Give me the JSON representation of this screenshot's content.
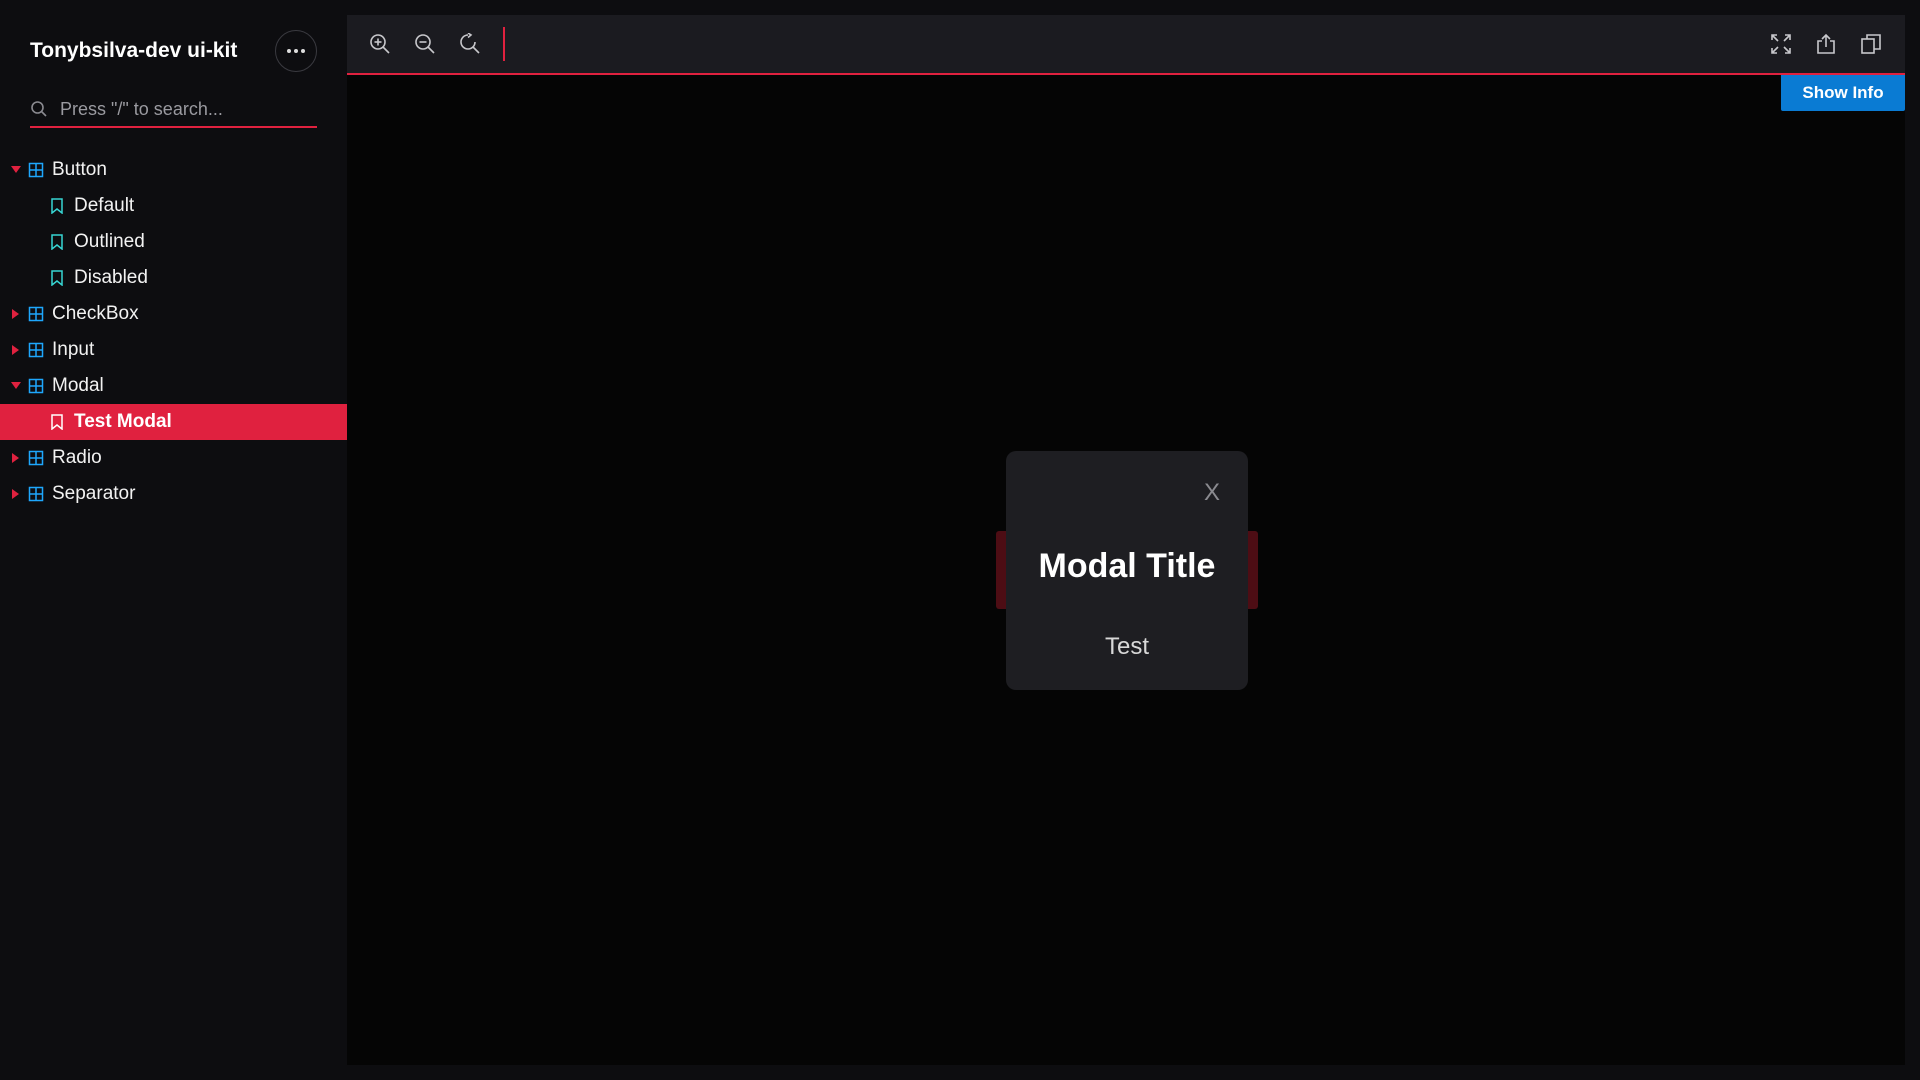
{
  "sidebar": {
    "brand": "Tonybsilva-dev ui-kit",
    "search_placeholder": "Press \"/\" to search...",
    "items": [
      {
        "label": "Button",
        "type": "group",
        "expanded": true
      },
      {
        "label": "Default",
        "type": "story"
      },
      {
        "label": "Outlined",
        "type": "story"
      },
      {
        "label": "Disabled",
        "type": "story"
      },
      {
        "label": "CheckBox",
        "type": "group",
        "expanded": false
      },
      {
        "label": "Input",
        "type": "group",
        "expanded": false
      },
      {
        "label": "Modal",
        "type": "group",
        "expanded": true
      },
      {
        "label": "Test Modal",
        "type": "story",
        "active": true
      },
      {
        "label": "Radio",
        "type": "group",
        "expanded": false
      },
      {
        "label": "Separator",
        "type": "group",
        "expanded": false
      }
    ]
  },
  "toolbar": {
    "icons": [
      "zoom-in-icon",
      "zoom-out-icon",
      "reset-zoom-icon",
      "fullscreen-icon",
      "share-icon",
      "copy-icon"
    ],
    "show_info_label": "Show Info"
  },
  "modal": {
    "close_label": "X",
    "title": "Modal Title",
    "body": "Test"
  },
  "colors": {
    "accent": "#e0213f",
    "info_button": "#0a7bd3",
    "icon_blue": "#1ea7fd",
    "story_icon": "#37d5d3"
  }
}
